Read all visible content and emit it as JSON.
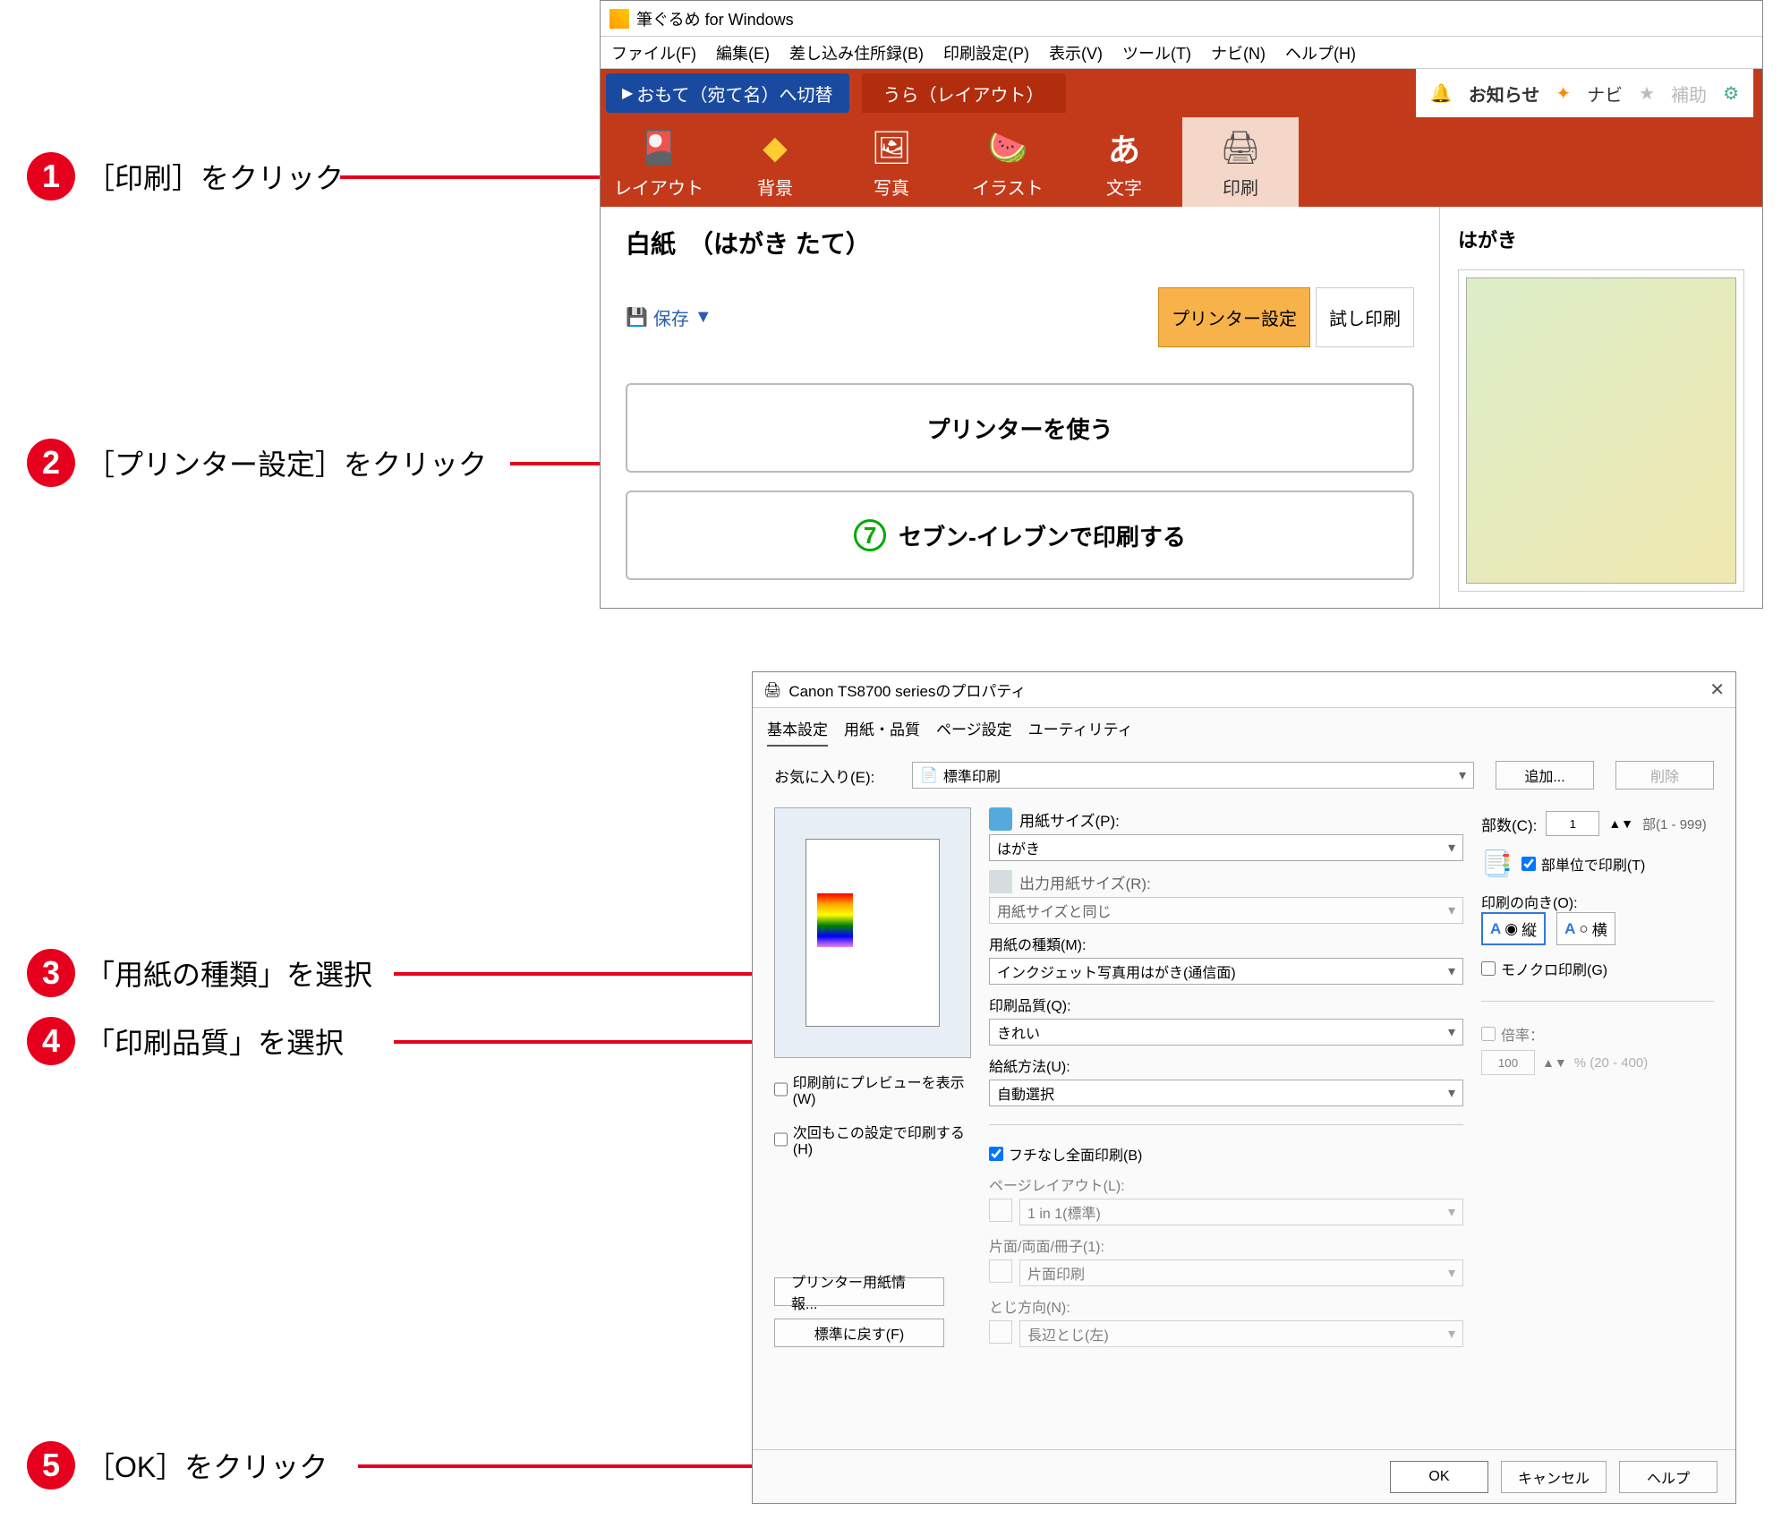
{
  "steps": {
    "s1": {
      "num": "1",
      "text": "［印刷］をクリック"
    },
    "s2": {
      "num": "2",
      "text": "［プリンター設定］をクリック"
    },
    "s3": {
      "num": "3",
      "text": "「用紙の種類」を選択"
    },
    "s4": {
      "num": "4",
      "text": "「印刷品質」を選択"
    },
    "s5": {
      "num": "5",
      "text": "［OK］をクリック"
    }
  },
  "win1": {
    "title": "筆ぐるめ for Windows",
    "menu": [
      "ファイル(F)",
      "編集(E)",
      "差し込み住所録(B)",
      "印刷設定(P)",
      "表示(V)",
      "ツール(T)",
      "ナビ(N)",
      "ヘルプ(H)"
    ],
    "tab_switch": "おもて（宛て名）へ切替",
    "tab_ura": "うら（レイアウト）",
    "notice": "お知らせ",
    "navi": "ナビ",
    "hojo": "補助",
    "tools": [
      {
        "label": "レイアウト",
        "icon": "🎴"
      },
      {
        "label": "背景",
        "icon": "◆"
      },
      {
        "label": "写真",
        "icon": "🖼"
      },
      {
        "label": "イラスト",
        "icon": "🍉"
      },
      {
        "label": "文字",
        "icon": "あ"
      },
      {
        "label": "印刷",
        "icon": "🖨"
      }
    ],
    "paper_title": "白紙　（はがき たて）",
    "save": "保存",
    "printer_settings": "プリンター設定",
    "test_print": "試し印刷",
    "use_printer": "プリンターを使う",
    "seven": "セブン‐イレブンで印刷する",
    "hagaki": "はがき"
  },
  "win2": {
    "title": "Canon TS8700 seriesのプロパティ",
    "tabs": [
      "基本設定",
      "用紙・品質",
      "ページ設定",
      "ユーティリティ"
    ],
    "fav_label": "お気に入り(E):",
    "fav_value": "標準印刷",
    "add": "追加...",
    "delete": "削除",
    "paper_size_label": "用紙サイズ(P):",
    "paper_size_value": "はがき",
    "output_size_label": "出力用紙サイズ(R):",
    "output_size_value": "用紙サイズと同じ",
    "paper_type_label": "用紙の種類(M):",
    "paper_type_value": "インクジェット写真用はがき(通信面)",
    "quality_label": "印刷品質(Q):",
    "quality_value": "きれい",
    "feed_label": "給紙方法(U):",
    "feed_value": "自動選択",
    "borderless": "フチなし全面印刷(B)",
    "page_layout_label": "ページレイアウト(L):",
    "page_layout_value": "1 in 1(標準)",
    "duplex_label": "片面/両面/冊子(1):",
    "duplex_value": "片面印刷",
    "binding_label": "とじ方向(N):",
    "binding_value": "長辺とじ(左)",
    "preview_before": "印刷前にプレビューを表示(W)",
    "always_use": "次回もこの設定で印刷する(H)",
    "printer_info": "プリンター用紙情報...",
    "restore": "標準に戻す(F)",
    "copies_label": "部数(C):",
    "copies_value": "1",
    "copies_range": "部(1 - 999)",
    "collate": "部単位で印刷(T)",
    "orient_label": "印刷の向き(O):",
    "orient_portrait": "縦",
    "orient_landscape": "横",
    "mono": "モノクロ印刷(G)",
    "scale_label": "倍率：",
    "scale_value": "100",
    "scale_range": "% (20 - 400)",
    "ok": "OK",
    "cancel": "キャンセル",
    "help": "ヘルプ"
  }
}
